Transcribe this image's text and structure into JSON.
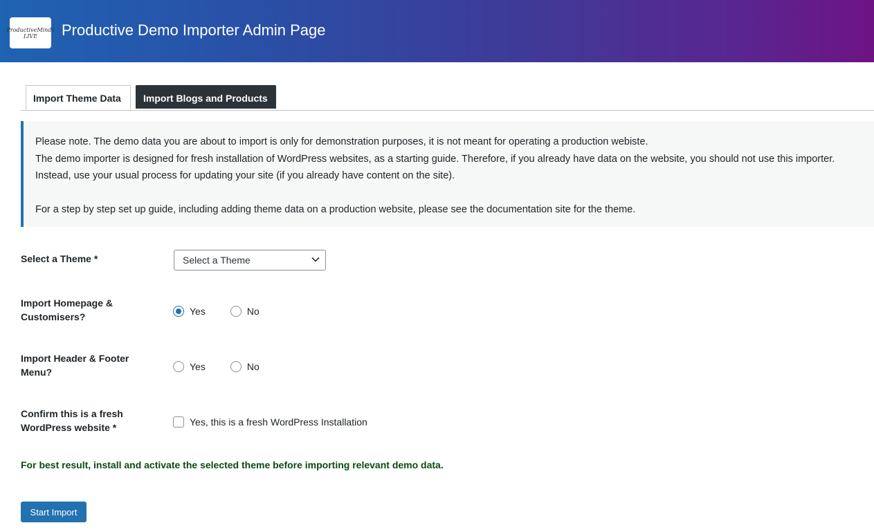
{
  "header": {
    "logo_line1": "ProductiveMinds",
    "logo_line2": "LIVE",
    "title": "Productive Demo Importer Admin Page",
    "gradient_colors": [
      "#1f63b3",
      "#6e1384"
    ]
  },
  "tabs": [
    {
      "label": "Import Theme Data",
      "active": true
    },
    {
      "label": "Import Blogs and Products",
      "active": false
    }
  ],
  "notice": {
    "lines": [
      "Please note. The demo data you are about to import is only for demonstration purposes, it is not meant for operating a production webiste.",
      "The demo importer is designed for fresh installation of WordPress websites, as a starting guide. Therefore, if you already have data on the website, you should not use this importer.",
      "Instead, use your usual process for updating your site (if you already have content on the site).",
      "For a step by step set up guide, including adding theme data on a production website, please see the documentation site for the theme."
    ],
    "accent_color": "#2271b1"
  },
  "form": {
    "theme": {
      "label": "Select a Theme *",
      "selected": "Select a Theme"
    },
    "homepage": {
      "label_line1": "Import Homepage &",
      "label_line2": "Customisers?",
      "yes_label": "Yes",
      "no_label": "No",
      "selected": "Yes"
    },
    "header_footer": {
      "label_line1": "Import Header & Footer",
      "label_line2": "Menu?",
      "yes_label": "Yes",
      "no_label": "No",
      "selected": null
    },
    "fresh": {
      "label_line1": "Confirm this is a fresh",
      "label_line2": "WordPress website *",
      "checkbox_label": "Yes, this is a fresh WordPress Installation",
      "checked": false
    },
    "hint": "For best result, install and activate the selected theme before importing relevant demo data.",
    "submit_label": "Start Import",
    "primary_color": "#2271b1"
  }
}
